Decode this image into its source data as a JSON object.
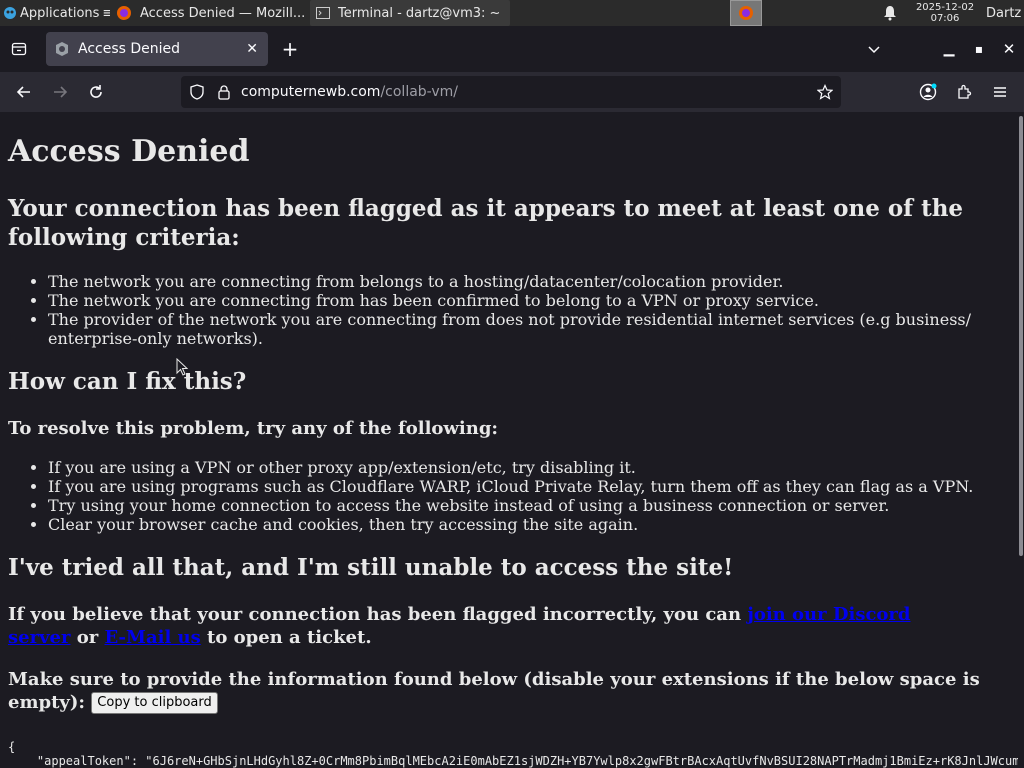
{
  "panel": {
    "apps_label": "Applications",
    "tasks": [
      {
        "title": "Access Denied — Mozill..."
      },
      {
        "title": "Terminal - dartz@vm3: ~"
      }
    ],
    "clock_date": "2025-12-02",
    "clock_time": "07:06",
    "user": "Dartz"
  },
  "browser": {
    "tab_title": "Access Denied",
    "url_domain": "computernewb.com",
    "url_path": "/collab-vm/"
  },
  "page": {
    "title": "Access Denied",
    "flag_heading": "Your connection has been flagged as it appears to meet at least one of the following criteria:",
    "criteria": [
      "The network you are connecting from belongs to a hosting/datacenter/colocation provider.",
      "The network you are connecting from has been confirmed to belong to a VPN or proxy service.",
      "The provider of the network you are connecting from does not provide residential internet services (e.g business/ enterprise-only networks)."
    ],
    "fix_heading": "How can I fix this?",
    "resolve_heading": "To resolve this problem, try any of the following:",
    "fixes": [
      "If you are using a VPN or other proxy app/extension/etc, try disabling it.",
      "If you are using programs such as Cloudflare WARP, iCloud Private Relay, turn them off as they can flag as a VPN.",
      "Try using your home connection to access the website instead of using a business connection or server.",
      "Clear your browser cache and cookies, then try accessing the site again."
    ],
    "tried_heading": "I've tried all that, and I'm still unable to access the site!",
    "incorrect_pre": "If you believe that your connection has been flagged incorrectly, you can ",
    "discord_link": "join our Discord server",
    "incorrect_or": " or ",
    "email_link": "E-Mail us",
    "incorrect_post": " to open a ticket.",
    "provide_info": "Make sure to provide the information found below (disable your extensions if the below space is empty): ",
    "copy_button": "Copy to clipboard",
    "json_open": "{",
    "json_line": "    \"appealToken\": \"6J6reN+GHbSjnLHdGyhl8Z+0CrMm8PbimBqlMEbcA2iE0mAbEZ1sjWDZH+YB7Ywlp8x2gwFBtrBAcxAqtUvfNvBSUI28NAPTrMadmj1BmiEz+rK8JnlJWcumR"
  },
  "colors": {
    "page_bg": "#1c1b22",
    "toolbar_bg": "#2b2a33",
    "link": "#0000ee",
    "text": "#e8e8e8"
  }
}
